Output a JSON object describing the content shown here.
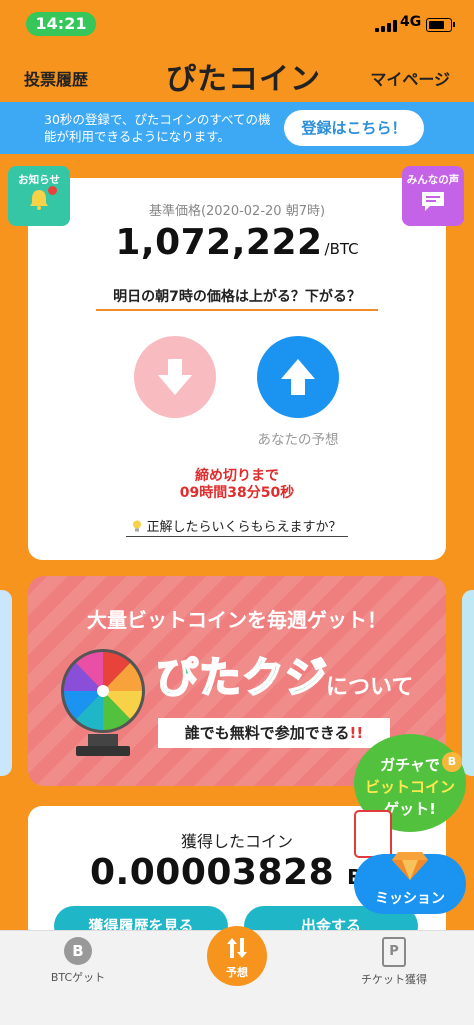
{
  "status_bar": {
    "time": "14:21",
    "network": "4G"
  },
  "header": {
    "left_link": "投票履歴",
    "logo": "ぴたコイン",
    "right_link": "マイページ"
  },
  "banner": {
    "text": "30秒の登録で、ぴたコインのすべての機能が利用できるようになります。",
    "button": "登録はこちら！"
  },
  "side_buttons": {
    "notice": "お知らせ",
    "voices": "みんなの声"
  },
  "prediction": {
    "base_price_label": "基準価格(2020-02-20 朝7時)",
    "price": "1,072,222",
    "unit": "/BTC",
    "question": "明日の朝7時の価格は上がる？下がる？",
    "your_prediction": "あなたの予想",
    "deadline_line1": "締め切りまで",
    "deadline_line2": "09時間38分50秒",
    "reward_link": "正解したらいくらもらえますか？"
  },
  "kuji": {
    "headline": "大量ビットコインを毎週ゲット！",
    "name": "ぴたクジ",
    "about": "について",
    "free": "誰でも無料で参加できる",
    "free_mark": "!!"
  },
  "gacha": {
    "line1": "ガチャで",
    "line2": "ビットコイン",
    "line3": "ゲット!",
    "coin": "B"
  },
  "coins": {
    "title": "獲得したコイン",
    "value": "0.00003828",
    "unit": "BT",
    "history_button": "獲得履歴を見る",
    "withdraw_button": "出金する"
  },
  "mission": {
    "label": "ミッション"
  },
  "tab_bar": {
    "btc": {
      "label": "BTCゲット",
      "glyph": "B"
    },
    "predict": {
      "label": "予想"
    },
    "ticket": {
      "label": "チケット獲得",
      "glyph": "P"
    }
  },
  "colors": {
    "background": "#f7941d",
    "banner": "#3da9f5",
    "up": "#1b93f1",
    "down": "#f8bcc0",
    "teal": "#1fb7c7",
    "kuji": "#ef7f7f"
  }
}
